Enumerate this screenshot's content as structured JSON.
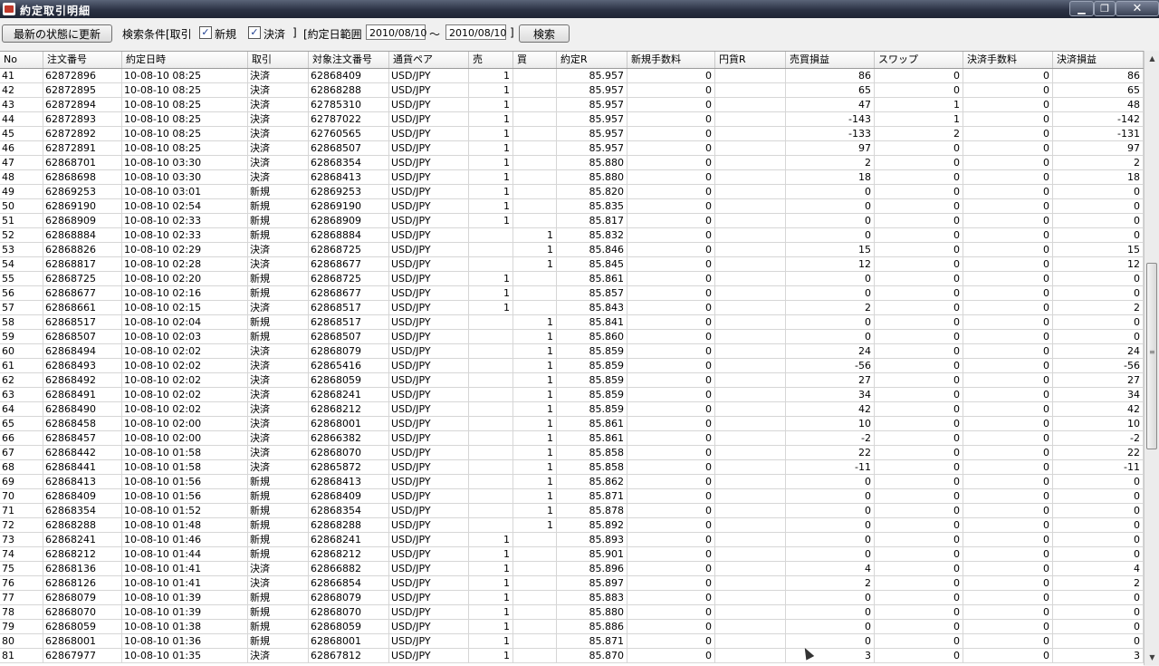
{
  "window": {
    "title": "約定取引明細"
  },
  "toolbar": {
    "refresh_label": "最新の状態に更新",
    "search_cond_label": "検索条件[取引",
    "new_label": "新規",
    "settle_label": "決済",
    "bracket_close": "]",
    "date_range_label": "[約定日範囲",
    "date_from": "2010/08/10",
    "tilde": "～",
    "date_to": "2010/08/10",
    "bracket_close2": "]",
    "search_label": "検索",
    "new_checked_mark": "✓",
    "settle_checked_mark": "✓"
  },
  "table": {
    "columns": [
      "No",
      "注文番号",
      "約定日時",
      "取引",
      "対象注文番号",
      "通貨ペア",
      "売",
      "買",
      "約定R",
      "新規手数料",
      "円貨R",
      "売買損益",
      "スワップ",
      "決済手数料",
      "決済損益"
    ],
    "rows": [
      [
        "41",
        "62872896",
        "10-08-10 08:25",
        "決済",
        "62868409",
        "USD/JPY",
        "1",
        "",
        "85.957",
        "0",
        "",
        "86",
        "0",
        "0",
        "86"
      ],
      [
        "42",
        "62872895",
        "10-08-10 08:25",
        "決済",
        "62868288",
        "USD/JPY",
        "1",
        "",
        "85.957",
        "0",
        "",
        "65",
        "0",
        "0",
        "65"
      ],
      [
        "43",
        "62872894",
        "10-08-10 08:25",
        "決済",
        "62785310",
        "USD/JPY",
        "1",
        "",
        "85.957",
        "0",
        "",
        "47",
        "1",
        "0",
        "48"
      ],
      [
        "44",
        "62872893",
        "10-08-10 08:25",
        "決済",
        "62787022",
        "USD/JPY",
        "1",
        "",
        "85.957",
        "0",
        "",
        "-143",
        "1",
        "0",
        "-142"
      ],
      [
        "45",
        "62872892",
        "10-08-10 08:25",
        "決済",
        "62760565",
        "USD/JPY",
        "1",
        "",
        "85.957",
        "0",
        "",
        "-133",
        "2",
        "0",
        "-131"
      ],
      [
        "46",
        "62872891",
        "10-08-10 08:25",
        "決済",
        "62868507",
        "USD/JPY",
        "1",
        "",
        "85.957",
        "0",
        "",
        "97",
        "0",
        "0",
        "97"
      ],
      [
        "47",
        "62868701",
        "10-08-10 03:30",
        "決済",
        "62868354",
        "USD/JPY",
        "1",
        "",
        "85.880",
        "0",
        "",
        "2",
        "0",
        "0",
        "2"
      ],
      [
        "48",
        "62868698",
        "10-08-10 03:30",
        "決済",
        "62868413",
        "USD/JPY",
        "1",
        "",
        "85.880",
        "0",
        "",
        "18",
        "0",
        "0",
        "18"
      ],
      [
        "49",
        "62869253",
        "10-08-10 03:01",
        "新規",
        "62869253",
        "USD/JPY",
        "1",
        "",
        "85.820",
        "0",
        "",
        "0",
        "0",
        "0",
        "0"
      ],
      [
        "50",
        "62869190",
        "10-08-10 02:54",
        "新規",
        "62869190",
        "USD/JPY",
        "1",
        "",
        "85.835",
        "0",
        "",
        "0",
        "0",
        "0",
        "0"
      ],
      [
        "51",
        "62868909",
        "10-08-10 02:33",
        "新規",
        "62868909",
        "USD/JPY",
        "1",
        "",
        "85.817",
        "0",
        "",
        "0",
        "0",
        "0",
        "0"
      ],
      [
        "52",
        "62868884",
        "10-08-10 02:33",
        "新規",
        "62868884",
        "USD/JPY",
        "",
        "1",
        "85.832",
        "0",
        "",
        "0",
        "0",
        "0",
        "0"
      ],
      [
        "53",
        "62868826",
        "10-08-10 02:29",
        "決済",
        "62868725",
        "USD/JPY",
        "",
        "1",
        "85.846",
        "0",
        "",
        "15",
        "0",
        "0",
        "15"
      ],
      [
        "54",
        "62868817",
        "10-08-10 02:28",
        "決済",
        "62868677",
        "USD/JPY",
        "",
        "1",
        "85.845",
        "0",
        "",
        "12",
        "0",
        "0",
        "12"
      ],
      [
        "55",
        "62868725",
        "10-08-10 02:20",
        "新規",
        "62868725",
        "USD/JPY",
        "1",
        "",
        "85.861",
        "0",
        "",
        "0",
        "0",
        "0",
        "0"
      ],
      [
        "56",
        "62868677",
        "10-08-10 02:16",
        "新規",
        "62868677",
        "USD/JPY",
        "1",
        "",
        "85.857",
        "0",
        "",
        "0",
        "0",
        "0",
        "0"
      ],
      [
        "57",
        "62868661",
        "10-08-10 02:15",
        "決済",
        "62868517",
        "USD/JPY",
        "1",
        "",
        "85.843",
        "0",
        "",
        "2",
        "0",
        "0",
        "2"
      ],
      [
        "58",
        "62868517",
        "10-08-10 02:04",
        "新規",
        "62868517",
        "USD/JPY",
        "",
        "1",
        "85.841",
        "0",
        "",
        "0",
        "0",
        "0",
        "0"
      ],
      [
        "59",
        "62868507",
        "10-08-10 02:03",
        "新規",
        "62868507",
        "USD/JPY",
        "",
        "1",
        "85.860",
        "0",
        "",
        "0",
        "0",
        "0",
        "0"
      ],
      [
        "60",
        "62868494",
        "10-08-10 02:02",
        "決済",
        "62868079",
        "USD/JPY",
        "",
        "1",
        "85.859",
        "0",
        "",
        "24",
        "0",
        "0",
        "24"
      ],
      [
        "61",
        "62868493",
        "10-08-10 02:02",
        "決済",
        "62865416",
        "USD/JPY",
        "",
        "1",
        "85.859",
        "0",
        "",
        "-56",
        "0",
        "0",
        "-56"
      ],
      [
        "62",
        "62868492",
        "10-08-10 02:02",
        "決済",
        "62868059",
        "USD/JPY",
        "",
        "1",
        "85.859",
        "0",
        "",
        "27",
        "0",
        "0",
        "27"
      ],
      [
        "63",
        "62868491",
        "10-08-10 02:02",
        "決済",
        "62868241",
        "USD/JPY",
        "",
        "1",
        "85.859",
        "0",
        "",
        "34",
        "0",
        "0",
        "34"
      ],
      [
        "64",
        "62868490",
        "10-08-10 02:02",
        "決済",
        "62868212",
        "USD/JPY",
        "",
        "1",
        "85.859",
        "0",
        "",
        "42",
        "0",
        "0",
        "42"
      ],
      [
        "65",
        "62868458",
        "10-08-10 02:00",
        "決済",
        "62868001",
        "USD/JPY",
        "",
        "1",
        "85.861",
        "0",
        "",
        "10",
        "0",
        "0",
        "10"
      ],
      [
        "66",
        "62868457",
        "10-08-10 02:00",
        "決済",
        "62866382",
        "USD/JPY",
        "",
        "1",
        "85.861",
        "0",
        "",
        "-2",
        "0",
        "0",
        "-2"
      ],
      [
        "67",
        "62868442",
        "10-08-10 01:58",
        "決済",
        "62868070",
        "USD/JPY",
        "",
        "1",
        "85.858",
        "0",
        "",
        "22",
        "0",
        "0",
        "22"
      ],
      [
        "68",
        "62868441",
        "10-08-10 01:58",
        "決済",
        "62865872",
        "USD/JPY",
        "",
        "1",
        "85.858",
        "0",
        "",
        "-11",
        "0",
        "0",
        "-11"
      ],
      [
        "69",
        "62868413",
        "10-08-10 01:56",
        "新規",
        "62868413",
        "USD/JPY",
        "",
        "1",
        "85.862",
        "0",
        "",
        "0",
        "0",
        "0",
        "0"
      ],
      [
        "70",
        "62868409",
        "10-08-10 01:56",
        "新規",
        "62868409",
        "USD/JPY",
        "",
        "1",
        "85.871",
        "0",
        "",
        "0",
        "0",
        "0",
        "0"
      ],
      [
        "71",
        "62868354",
        "10-08-10 01:52",
        "新規",
        "62868354",
        "USD/JPY",
        "",
        "1",
        "85.878",
        "0",
        "",
        "0",
        "0",
        "0",
        "0"
      ],
      [
        "72",
        "62868288",
        "10-08-10 01:48",
        "新規",
        "62868288",
        "USD/JPY",
        "",
        "1",
        "85.892",
        "0",
        "",
        "0",
        "0",
        "0",
        "0"
      ],
      [
        "73",
        "62868241",
        "10-08-10 01:46",
        "新規",
        "62868241",
        "USD/JPY",
        "1",
        "",
        "85.893",
        "0",
        "",
        "0",
        "0",
        "0",
        "0"
      ],
      [
        "74",
        "62868212",
        "10-08-10 01:44",
        "新規",
        "62868212",
        "USD/JPY",
        "1",
        "",
        "85.901",
        "0",
        "",
        "0",
        "0",
        "0",
        "0"
      ],
      [
        "75",
        "62868136",
        "10-08-10 01:41",
        "決済",
        "62866882",
        "USD/JPY",
        "1",
        "",
        "85.896",
        "0",
        "",
        "4",
        "0",
        "0",
        "4"
      ],
      [
        "76",
        "62868126",
        "10-08-10 01:41",
        "決済",
        "62866854",
        "USD/JPY",
        "1",
        "",
        "85.897",
        "0",
        "",
        "2",
        "0",
        "0",
        "2"
      ],
      [
        "77",
        "62868079",
        "10-08-10 01:39",
        "新規",
        "62868079",
        "USD/JPY",
        "1",
        "",
        "85.883",
        "0",
        "",
        "0",
        "0",
        "0",
        "0"
      ],
      [
        "78",
        "62868070",
        "10-08-10 01:39",
        "新規",
        "62868070",
        "USD/JPY",
        "1",
        "",
        "85.880",
        "0",
        "",
        "0",
        "0",
        "0",
        "0"
      ],
      [
        "79",
        "62868059",
        "10-08-10 01:38",
        "新規",
        "62868059",
        "USD/JPY",
        "1",
        "",
        "85.886",
        "0",
        "",
        "0",
        "0",
        "0",
        "0"
      ],
      [
        "80",
        "62868001",
        "10-08-10 01:36",
        "新規",
        "62868001",
        "USD/JPY",
        "1",
        "",
        "85.871",
        "0",
        "",
        "0",
        "0",
        "0",
        "0"
      ],
      [
        "81",
        "62867977",
        "10-08-10 01:35",
        "決済",
        "62867812",
        "USD/JPY",
        "1",
        "",
        "85.870",
        "0",
        "",
        "3",
        "0",
        "0",
        "3"
      ]
    ]
  },
  "icons": {
    "minimize": "▁",
    "maximize": "❐",
    "close": "✕",
    "scroll_up": "▲",
    "scroll_down": "▼",
    "grip": "≡"
  }
}
